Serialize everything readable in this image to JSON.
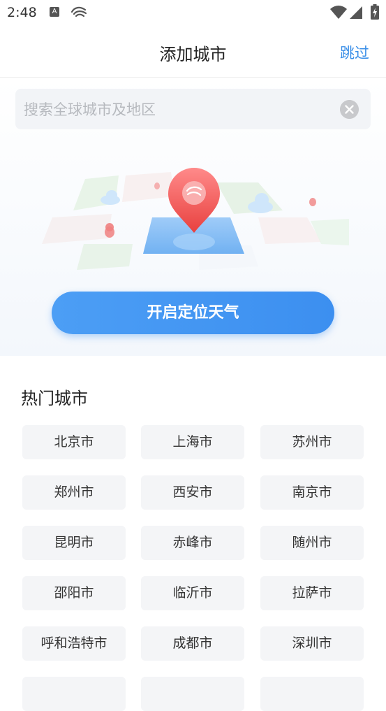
{
  "status_bar": {
    "time": "2:48",
    "a_icon_text": "A"
  },
  "header": {
    "title": "添加城市",
    "skip_label": "跳过"
  },
  "search": {
    "placeholder": "搜索全球城市及地区",
    "value": ""
  },
  "locate_button_label": "开启定位天气",
  "hot_cities": {
    "title": "热门城市",
    "cities": [
      "北京市",
      "上海市",
      "苏州市",
      "郑州市",
      "西安市",
      "南京市",
      "昆明市",
      "赤峰市",
      "随州市",
      "邵阳市",
      "临沂市",
      "拉萨市",
      "呼和浩特市",
      "成都市",
      "深圳市"
    ]
  },
  "colors": {
    "accent": "#3b8fe8",
    "button_gradient_start": "#4c9ef5",
    "button_gradient_end": "#3c8ff0",
    "pin": "#f05a5a",
    "city_bg": "#f4f5f7"
  }
}
